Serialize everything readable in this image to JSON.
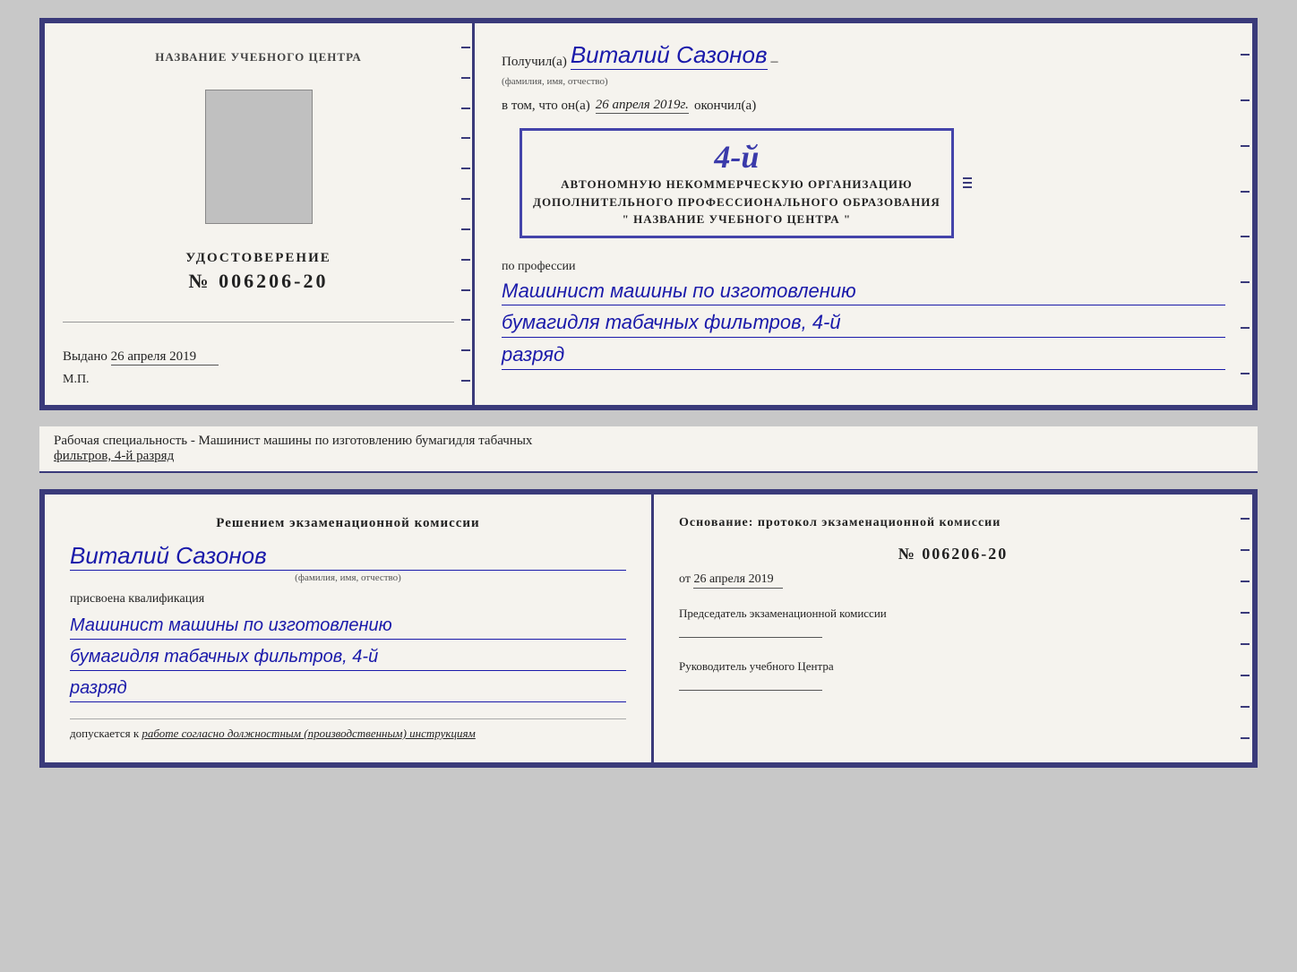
{
  "top_cert": {
    "left": {
      "training_center_label": "НАЗВАНИЕ УЧЕБНОГО ЦЕНТРА",
      "cert_label": "УДОСТОВЕРЕНИЕ",
      "cert_number": "№ 006206-20",
      "issued_label": "Выдано",
      "issued_date": "26 апреля 2019",
      "mp_label": "М.П."
    },
    "right": {
      "received_prefix": "Получил(а)",
      "recipient_name": "Виталий Сазонов",
      "recipient_subtext": "(фамилия, имя, отчество)",
      "dash": "–",
      "vtom_prefix": "в том, что он(а)",
      "vtom_date": "26 апреля 2019г.",
      "okончил_label": "окончил(а)",
      "stamp_number": "4-й",
      "stamp_line1": "АВТОНОМНУЮ НЕКОММЕРЧЕСКУЮ ОРГАНИЗАЦИЮ",
      "stamp_line2": "ДОПОЛНИТЕЛЬНОГО ПРОФЕССИОНАЛЬНОГО ОБРАЗОВАНИЯ",
      "stamp_line3": "\" НАЗВАНИЕ УЧЕБНОГО ЦЕНТРА \"",
      "profession_label": "по профессии",
      "profession_line1": "Машинист машины по изготовлению",
      "profession_line2": "бумагидля табачных фильтров, 4-й",
      "profession_line3": "разряд"
    }
  },
  "middle": {
    "text": "Рабочая специальность - Машинист машины по изготовлению бумагидля табачных",
    "text2_underline": "фильтров, 4-й разряд"
  },
  "bottom_cert": {
    "left": {
      "komissia_title": "Решением  экзаменационной  комиссии",
      "person_name": "Виталий Сазонов",
      "person_subtext": "(фамилия, имя, отчество)",
      "assigned_label": "присвоена квалификация",
      "qualification_line1": "Машинист машины по изготовлению",
      "qualification_line2": "бумагидля табачных фильтров, 4-й",
      "qualification_line3": "разряд",
      "допуск_prefix": "допускается к",
      "допуск_text": "работе согласно должностным (производственным) инструкциям"
    },
    "right": {
      "osnov_title": "Основание: протокол  экзаменационной  комиссии",
      "protocol_number": "№ 006206-20",
      "ot_prefix": "от",
      "ot_date": "26 апреля 2019",
      "chairman_label": "Председатель экзаменационной комиссии",
      "head_label": "Руководитель учебного Центра"
    }
  }
}
